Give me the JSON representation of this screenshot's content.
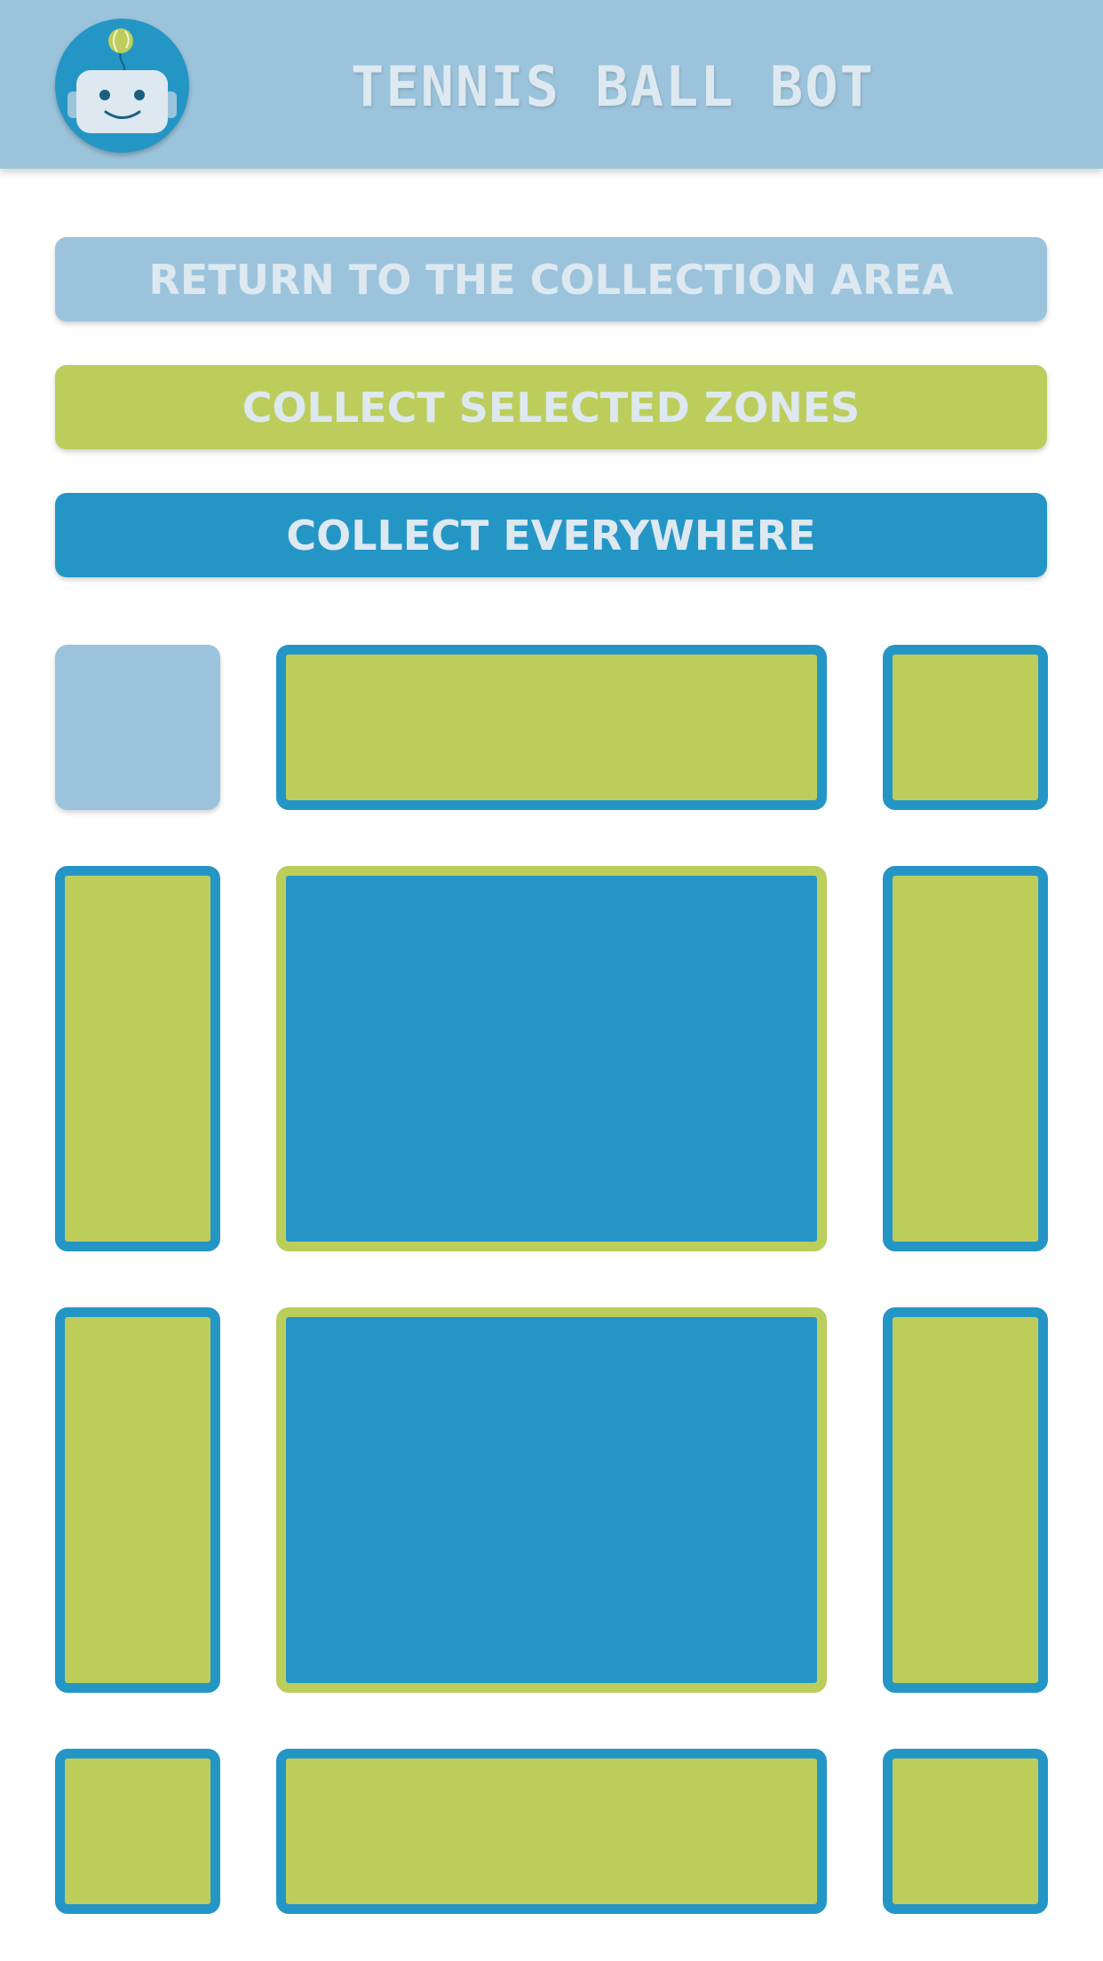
{
  "header": {
    "title": "TENNIS BALL BOT",
    "logo_icon": "robot-with-tennis-ball-icon"
  },
  "actions": {
    "return_label": "RETURN TO THE COLLECTION AREA",
    "collect_zones_label": "COLLECT SELECTED ZONES",
    "collect_everywhere_label": "COLLECT EVERYWHERE"
  },
  "court": {
    "rows": 4,
    "columns": 3,
    "zones": [
      {
        "id": "r1c1",
        "kind": "collection-area"
      },
      {
        "id": "r1c2",
        "kind": "zone"
      },
      {
        "id": "r1c3",
        "kind": "zone"
      },
      {
        "id": "r2c1",
        "kind": "zone"
      },
      {
        "id": "r2c2",
        "kind": "court-half"
      },
      {
        "id": "r2c3",
        "kind": "zone"
      },
      {
        "id": "r3c1",
        "kind": "zone"
      },
      {
        "id": "r3c2",
        "kind": "court-half"
      },
      {
        "id": "r3c3",
        "kind": "zone"
      },
      {
        "id": "r4c1",
        "kind": "zone"
      },
      {
        "id": "r4c2",
        "kind": "zone"
      },
      {
        "id": "r4c3",
        "kind": "zone"
      }
    ]
  },
  "colors": {
    "header_bg": "#9bc4dc",
    "title_text": "#dde8f0",
    "primary_blue": "#2496c6",
    "tennis_green": "#bdcd5c",
    "light_blue": "#9bc4dc"
  }
}
